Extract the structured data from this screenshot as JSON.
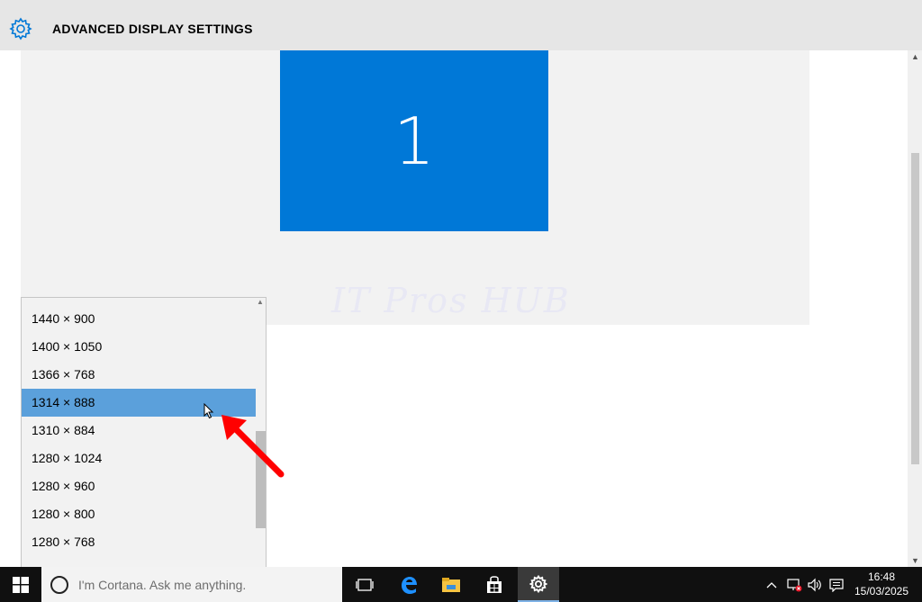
{
  "window": {
    "title": "ADVANCED DISPLAY SETTINGS",
    "settings_icon": "gear-icon"
  },
  "display_preview": {
    "monitor_number": "1",
    "watermark": "IT Pros HUB"
  },
  "resolution_dropdown": {
    "options": [
      {
        "label": "1440 × 900"
      },
      {
        "label": "1400 × 1050"
      },
      {
        "label": "1366 × 768"
      },
      {
        "label": "1314 × 888",
        "selected": true
      },
      {
        "label": "1310 × 884"
      },
      {
        "label": "1280 × 1024"
      },
      {
        "label": "1280 × 960"
      },
      {
        "label": "1280 × 800"
      },
      {
        "label": "1280 × 768"
      }
    ],
    "highlight_color": "#5ba0db"
  },
  "annotation": {
    "arrow_color": "#ff0000"
  },
  "taskbar": {
    "search_placeholder": "I'm Cortana. Ask me anything.",
    "icons": [
      "windows-start-icon",
      "task-view-icon",
      "edge-icon",
      "file-explorer-icon",
      "store-icon",
      "settings-icon"
    ],
    "tray": [
      "show-hidden-icons-chevron",
      "network-disconnected-icon",
      "volume-icon",
      "action-center-icon"
    ],
    "time": "16:48",
    "date": "15/03/2025"
  },
  "colors": {
    "accent": "#0078d7",
    "taskbar": "#101010"
  }
}
